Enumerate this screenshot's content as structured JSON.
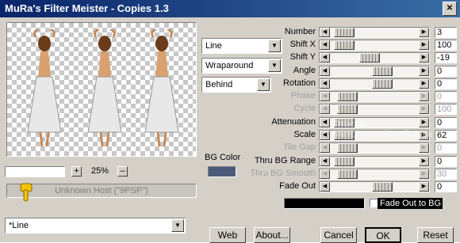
{
  "window": {
    "title": "MuRa's Filter Meister - Copies 1.3",
    "close_symbol": "✕"
  },
  "preview": {
    "zoom": "25%",
    "zoom_in": "+",
    "zoom_out": "–",
    "host": "Unknown Host (\"9PSP\")"
  },
  "combos": {
    "mode": "Line",
    "wrap": "Wraparound",
    "order": "Behind",
    "preset": "*Line"
  },
  "bg_color": {
    "label": "BG Color",
    "swatch": "#4a5a78"
  },
  "params": [
    {
      "label": "Number",
      "value": "3"
    },
    {
      "label": "Shift X",
      "value": "100"
    },
    {
      "label": "Shift Y",
      "value": "-19"
    },
    {
      "label": "Angle",
      "value": "0"
    },
    {
      "label": "Rotation",
      "value": "0"
    },
    {
      "label": "Phase",
      "value": "0"
    },
    {
      "label": "Cycle",
      "value": "100"
    },
    {
      "label": "Attenuation",
      "value": "0"
    },
    {
      "label": "Scale",
      "value": "62"
    },
    {
      "label": "Tile Gap",
      "value": "0"
    },
    {
      "label": "Thru BG Range",
      "value": "0"
    },
    {
      "label": "Thru BG Smooth",
      "value": "30"
    },
    {
      "label": "Fade Out",
      "value": "0"
    }
  ],
  "fade_to_bg": {
    "label": "Fade Out to BG"
  },
  "watermark": "Cnuccia www.tutorialgrafica.eu",
  "buttons": {
    "web": "Web",
    "about": "About...",
    "cancel": "Cancel",
    "ok": "OK",
    "reset": "Reset"
  }
}
